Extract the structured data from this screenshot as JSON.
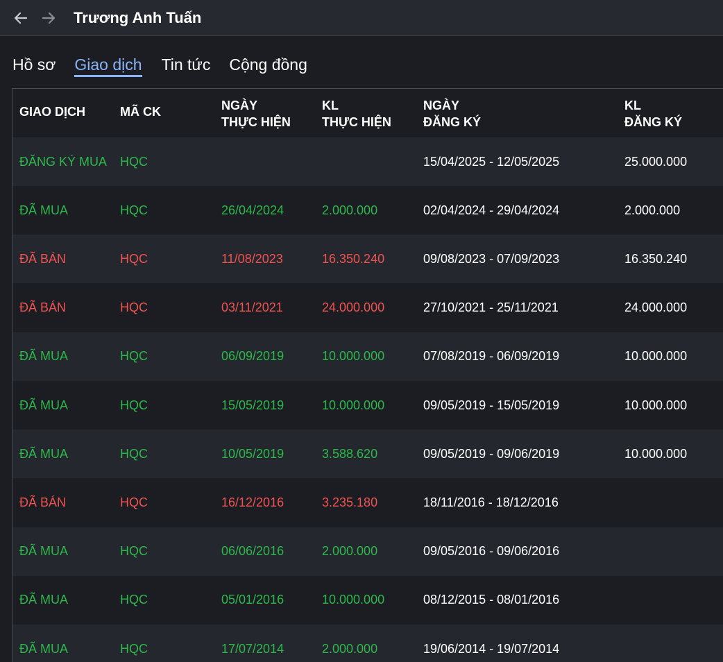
{
  "header": {
    "title": "Trương Anh Tuấn",
    "back_icon": "arrow-left-icon",
    "forward_icon": "arrow-right-icon"
  },
  "tabs": [
    {
      "label": "Hồ sơ",
      "active": false
    },
    {
      "label": "Giao dịch",
      "active": true
    },
    {
      "label": "Tin tức",
      "active": false
    },
    {
      "label": "Cộng đồng",
      "active": false
    }
  ],
  "colors": {
    "buy": "#2db84a",
    "sell": "#ef5350",
    "active_tab": "#8ab4f8"
  },
  "table": {
    "columns": [
      "GIAO DỊCH",
      "MÃ CK",
      "NGÀY\nTHỰC HIỆN",
      "KL\nTHỰC HIỆN",
      "NGÀY\nĐĂNG KÝ",
      "KL\nĐĂNG KÝ"
    ],
    "rows": [
      {
        "type": "buy",
        "action": "ĐĂNG KÝ MUA",
        "code": "HQC",
        "exec_date": "",
        "exec_qty": "",
        "reg_period": "15/04/2025 - 12/05/2025",
        "reg_qty": "25.000.000"
      },
      {
        "type": "buy",
        "action": "ĐÃ MUA",
        "code": "HQC",
        "exec_date": "26/04/2024",
        "exec_qty": "2.000.000",
        "reg_period": "02/04/2024 - 29/04/2024",
        "reg_qty": "2.000.000"
      },
      {
        "type": "sell",
        "action": "ĐÃ BÁN",
        "code": "HQC",
        "exec_date": "11/08/2023",
        "exec_qty": "16.350.240",
        "reg_period": "09/08/2023 - 07/09/2023",
        "reg_qty": "16.350.240"
      },
      {
        "type": "sell",
        "action": "ĐÃ BÁN",
        "code": "HQC",
        "exec_date": "03/11/2021",
        "exec_qty": "24.000.000",
        "reg_period": "27/10/2021 - 25/11/2021",
        "reg_qty": "24.000.000"
      },
      {
        "type": "buy",
        "action": "ĐÃ MUA",
        "code": "HQC",
        "exec_date": "06/09/2019",
        "exec_qty": "10.000.000",
        "reg_period": "07/08/2019 - 06/09/2019",
        "reg_qty": "10.000.000"
      },
      {
        "type": "buy",
        "action": "ĐÃ MUA",
        "code": "HQC",
        "exec_date": "15/05/2019",
        "exec_qty": "10.000.000",
        "reg_period": "09/05/2019 - 15/05/2019",
        "reg_qty": "10.000.000"
      },
      {
        "type": "buy",
        "action": "ĐÃ MUA",
        "code": "HQC",
        "exec_date": "10/05/2019",
        "exec_qty": "3.588.620",
        "reg_period": "09/05/2019 - 09/06/2019",
        "reg_qty": "10.000.000"
      },
      {
        "type": "sell",
        "action": "ĐÃ BÁN",
        "code": "HQC",
        "exec_date": "16/12/2016",
        "exec_qty": "3.235.180",
        "reg_period": "18/11/2016 - 18/12/2016",
        "reg_qty": ""
      },
      {
        "type": "buy",
        "action": "ĐÃ MUA",
        "code": "HQC",
        "exec_date": "06/06/2016",
        "exec_qty": "2.000.000",
        "reg_period": "09/05/2016 - 09/06/2016",
        "reg_qty": ""
      },
      {
        "type": "buy",
        "action": "ĐÃ MUA",
        "code": "HQC",
        "exec_date": "05/01/2016",
        "exec_qty": "10.000.000",
        "reg_period": "08/12/2015 - 08/01/2016",
        "reg_qty": ""
      },
      {
        "type": "buy",
        "action": "ĐÃ MUA",
        "code": "HQC",
        "exec_date": "17/07/2014",
        "exec_qty": "2.000.000",
        "reg_period": "19/06/2014 - 19/07/2014",
        "reg_qty": ""
      }
    ]
  }
}
